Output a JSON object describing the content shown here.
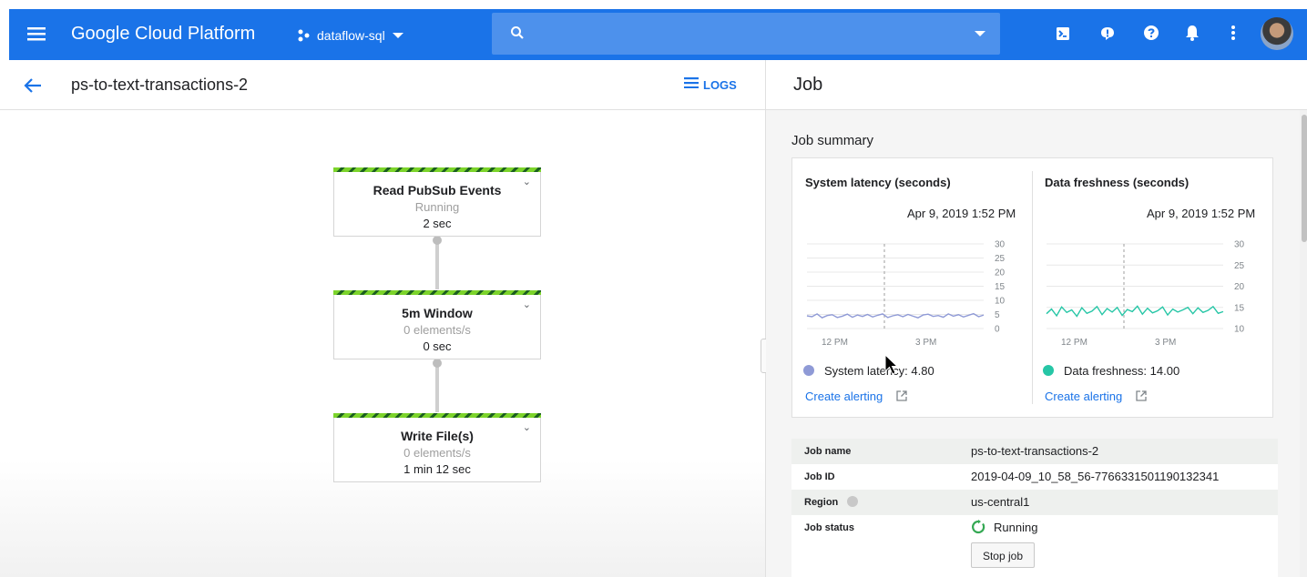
{
  "topbar": {
    "brand": "Google Cloud Platform",
    "project": "dataflow-sql",
    "icons": [
      "menu-icon",
      "project-icon",
      "dropdown-icon",
      "search-icon",
      "search-dropdown-icon",
      "cloud-shell-icon",
      "feedback-icon",
      "help-icon",
      "notifications-icon",
      "more-vert-icon",
      "avatar"
    ]
  },
  "job_header": {
    "title": "ps-to-text-transactions-2",
    "logs_label": "LOGS"
  },
  "graph": {
    "nodes": [
      {
        "title": "Read PubSub Events",
        "status": "Running",
        "duration": "2 sec"
      },
      {
        "title": "5m Window",
        "status": "0 elements/s",
        "duration": "0 sec"
      },
      {
        "title": "Write File(s)",
        "status": "0 elements/s",
        "duration": "1 min 12 sec"
      }
    ]
  },
  "panel": {
    "title": "Job",
    "summary_title": "Job summary"
  },
  "chart_data": [
    {
      "type": "line",
      "title": "System latency (seconds)",
      "timestamp": "Apr 9, 2019 1:52 PM",
      "x_ticks": [
        "12 PM",
        "3 PM"
      ],
      "y_ticks": [
        "30",
        "25",
        "20",
        "15",
        "10",
        "5",
        "0"
      ],
      "ylim": [
        0,
        30
      ],
      "series": [
        {
          "values": [
            4.5,
            4.2,
            5.2,
            3.8,
            4.6,
            4.9,
            3.9,
            4.4,
            5.1,
            4.0,
            4.8,
            4.3,
            5.0,
            4.1,
            4.7,
            5.2,
            3.9,
            4.5,
            4.9,
            4.2,
            5.0,
            4.4,
            3.8,
            4.8,
            5.1,
            4.3,
            4.6,
            4.0,
            5.2,
            4.4,
            4.9,
            4.1,
            4.7,
            5.3,
            4.2,
            4.8
          ]
        }
      ],
      "legend": "System latency: 4.80",
      "color": "#8f9ad6",
      "grid": true
    },
    {
      "type": "line",
      "title": "Data freshness (seconds)",
      "timestamp": "Apr 9, 2019 1:52 PM",
      "x_ticks": [
        "12 PM",
        "3 PM"
      ],
      "y_ticks": [
        "30",
        "25",
        "20",
        "15",
        "10"
      ],
      "ylim": [
        10,
        30
      ],
      "series": [
        {
          "values": [
            13.5,
            14.6,
            13.0,
            15.1,
            13.8,
            14.4,
            12.9,
            14.9,
            13.6,
            14.1,
            15.2,
            13.3,
            14.7,
            13.9,
            15.0,
            13.1,
            14.5,
            14.0,
            15.3,
            13.4,
            14.8,
            13.7,
            14.2,
            15.1,
            13.2,
            14.6,
            13.9,
            14.4,
            15.0,
            13.5,
            14.9,
            13.8,
            14.3,
            15.2,
            13.6,
            14.0
          ]
        }
      ],
      "legend": "Data freshness: 14.00",
      "color": "#26c6a6",
      "grid": true
    }
  ],
  "alerting": {
    "label": "Create alerting"
  },
  "job_info": [
    {
      "key": "Job name",
      "value": "ps-to-text-transactions-2"
    },
    {
      "key": "Job ID",
      "value": "2019-04-09_10_58_56-7766331501190132341"
    },
    {
      "key": "Region",
      "value": "us-central1"
    },
    {
      "key": "Job status",
      "value": "Running"
    }
  ],
  "stop_button": "Stop job",
  "colors": {
    "primary": "#1a73e8",
    "running": "#34a853"
  }
}
